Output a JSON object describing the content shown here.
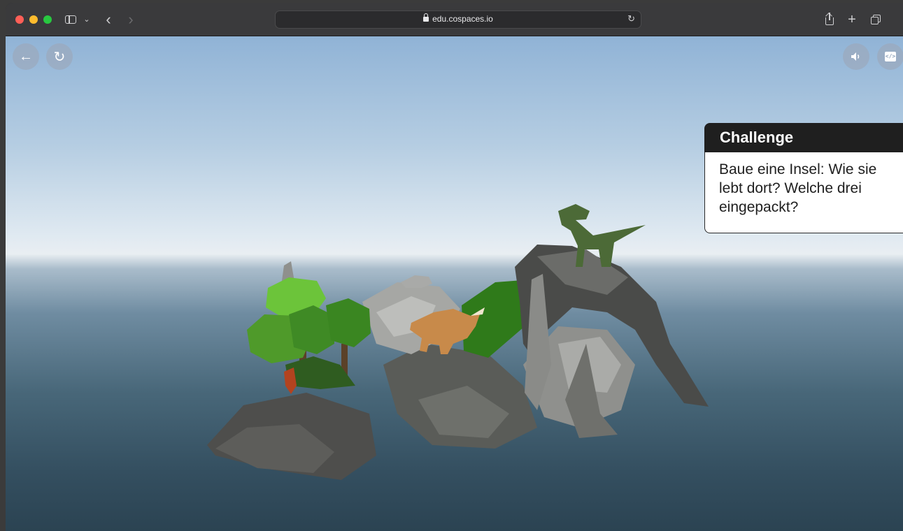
{
  "browser": {
    "url": "edu.cospaces.io",
    "icons": {
      "sidebar": "sidebar-icon",
      "chevron": "chevron-down-icon",
      "back": "back-arrow-icon",
      "forward": "forward-arrow-icon",
      "lock": "lock-icon",
      "reload": "reload-icon",
      "share": "share-icon",
      "new_tab": "plus-icon",
      "tabs": "tab-overview-icon"
    }
  },
  "player": {
    "buttons": {
      "back": "back-arrow-icon",
      "restart": "restart-icon",
      "sound": "speaker-icon",
      "code": "code-icon"
    }
  },
  "challenge": {
    "title": "Challenge",
    "lines": [
      "Baue eine Insel: Wie sie",
      "lebt dort? Welche drei",
      "eingepackt?"
    ]
  },
  "colors": {
    "close": "#ff5f57",
    "minimize": "#febc2e",
    "maximize": "#28c840",
    "challenge_header": "#1f1f1f"
  }
}
